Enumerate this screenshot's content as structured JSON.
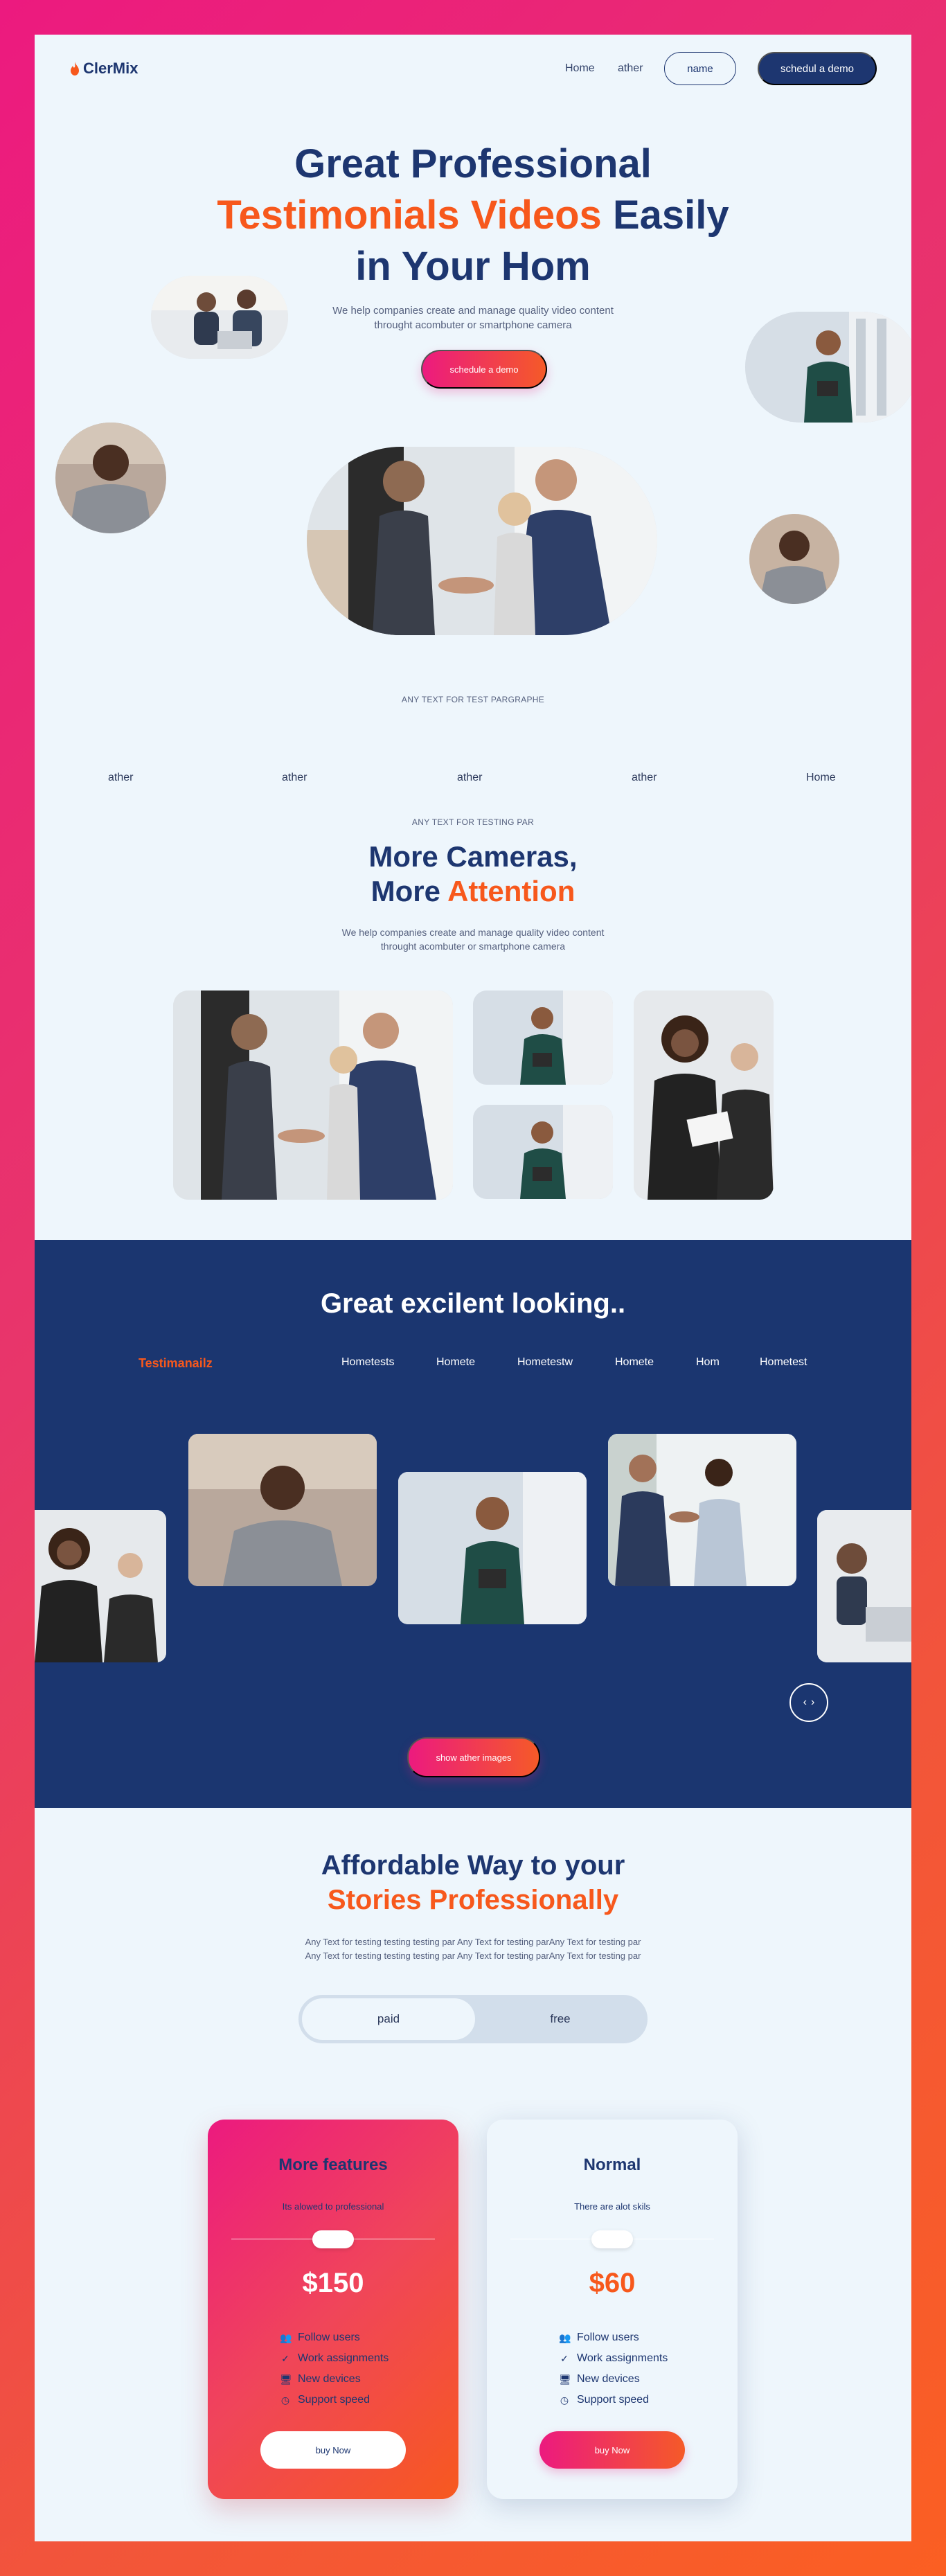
{
  "colors": {
    "navy": "#1d3670",
    "orange": "#f7581c",
    "pink": "#ec1a7f",
    "bg": "#eef6fc"
  },
  "header": {
    "logo": "ClerMix",
    "nav": [
      "Home",
      "ather"
    ],
    "name_button": "name",
    "demo_button": "schedul a demo"
  },
  "hero": {
    "title_line1": "Great Professional",
    "title_line2_accent": "Testimonials Videos",
    "title_line2_rest": " Easily",
    "title_line3": "in Your Hom",
    "subtitle_line1": "We help companies create and manage quality video content",
    "subtitle_line2": "throught acombuter or smartphone camera",
    "cta": "schedule a demo",
    "caption": "ANY TEXT FOR TEST PARGRAPHE"
  },
  "tabs": [
    "ather",
    "ather",
    "ather",
    "ather",
    "Home"
  ],
  "cameras": {
    "eyebrow": "ANY TEXT FOR TESTING PAR",
    "title_line1": "More Cameras,",
    "title_line2_plain": "More ",
    "title_line2_accent": "Attention",
    "subtitle_line1": "We help companies create and manage quality video content",
    "subtitle_line2": "throught acombuter or smartphone camera"
  },
  "testimonials": {
    "title": "Great excilent looking..",
    "brand": "Testimanailz",
    "links": [
      "Hometests",
      "Homete",
      "Hometestw",
      "Homete",
      "Hom",
      "Hometest"
    ],
    "show_button": "show ather images",
    "arrows": [
      "‹",
      "›"
    ]
  },
  "pricing": {
    "title_line1": "Affordable Way to your",
    "title_line2": "Stories Professionally",
    "subtitle_line1": "Any Text for testing testing testing par Any Text for testing parAny Text for testing par",
    "subtitle_line2": "Any Text for testing testing testing par Any Text for testing parAny Text for testing par",
    "toggle": {
      "on": "paid",
      "off": "free"
    },
    "plans": [
      {
        "name": "More features",
        "note": "Its alowed to professional",
        "price": "$150",
        "features": [
          "Follow users",
          "Work assignments",
          "New devices",
          "Support speed"
        ],
        "button": "buy Now"
      },
      {
        "name": "Normal",
        "note": "There are alot skils",
        "price": "$60",
        "features": [
          "Follow users",
          "Work assignments",
          "New devices",
          "Support speed"
        ],
        "button": "buy Now"
      }
    ],
    "feature_icons": [
      "users-icon",
      "check-icon",
      "monitor-icon",
      "clock-icon"
    ]
  }
}
